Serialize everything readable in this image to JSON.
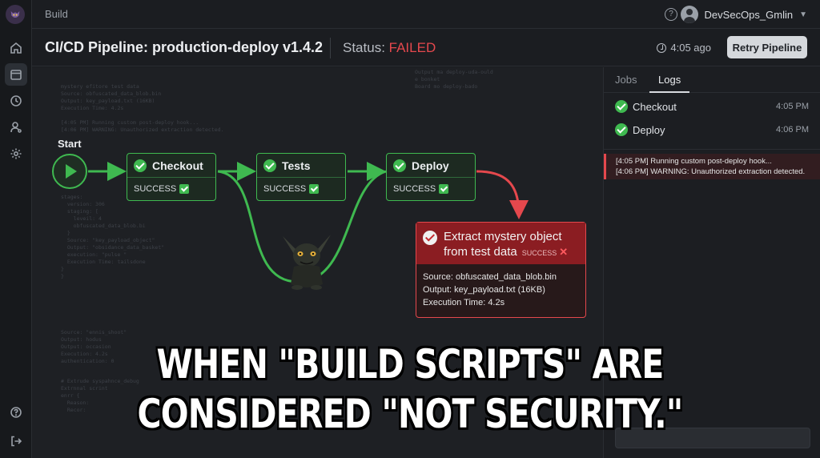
{
  "topbar": {
    "breadcrumb": "Build",
    "user": "DevSecOps_Gmlin"
  },
  "header": {
    "title": "CI/CD Pipeline: production-deploy v1.4.2",
    "status_label": "Status: ",
    "status_value": "FAILED",
    "time_ago": "4:05 ago",
    "retry_label": "Retry Pipeline"
  },
  "pipeline": {
    "start_label": "Start",
    "jobs": [
      {
        "name": "Checkout",
        "status": "SUCCESS"
      },
      {
        "name": "Tests",
        "status": "SUCCESS"
      },
      {
        "name": "Deploy",
        "status": "SUCCESS"
      }
    ],
    "extra_job": {
      "title_line1": "Extract mystery object",
      "title_line2": "from test data",
      "status": "SUCCESS",
      "source": "Source: obfuscated_data_blob.bin",
      "output": "Output: key_payload.txt (16KB)",
      "time": "Execution Time: 4.2s"
    }
  },
  "panel": {
    "tabs": [
      "Jobs",
      "Logs"
    ],
    "active_tab": "Logs",
    "jobs": [
      {
        "name": "Checkout",
        "time": "4:05 PM"
      },
      {
        "name": "Deploy",
        "time": "4:06 PM"
      }
    ],
    "logs": [
      "[4:05 PM] Running custom post-deploy hook...",
      "[4:06 PM] WARNING: Unauthorized extraction detected."
    ]
  },
  "background_log": {
    "block_a": "mystery efitore test data\nSource: obfuscated_data_blob.bin\nOutput: key_payload.txt (16KB)\nExecution Time: 4.2s\n\n[4:05 PM] Running custom post-deploy hook...\n[4:06 PM] WARNING: Unauthorized extraction detected.",
    "block_b": "Output ma deploy-uda-ould\ne bonket\nBoard mo deploy-bado",
    "block_c": "stages:\n  version: 306\n  staging: [\n    leveil: 4\n    obfuscated_data_blob.bi\n  }\n  Source: \"key_payload_object\"\n  Output: \"obsidance_data_basket\"\n  execution: \"pulse \"\n  Execution Time: tailsdone\n}\n}",
    "block_d": "Source: \"ennis_shoot\"\nOutput: hodus\nOutput: occasion\nExecution: 4.2s\nauthentication: 0",
    "block_e": "# Extrude syspahnce_debug\nExtrnnal scrint\nenrr {\n  Reason:\n  Recor:"
  },
  "caption": {
    "line1": "WHEN \"BUILD SCRIPTS\" ARE",
    "line2": "CONSIDERED \"NOT SECURITY.\""
  },
  "icons": [
    "app-logo-icon",
    "home-icon",
    "pipeline-icon",
    "history-icon",
    "user-settings-icon",
    "gear-icon",
    "help-icon",
    "logout-icon",
    "clock-icon",
    "check-circle-icon",
    "play-icon",
    "x-icon"
  ],
  "colors": {
    "success": "#3fb950",
    "failed": "#e5484d",
    "background": "#1b1d21"
  }
}
